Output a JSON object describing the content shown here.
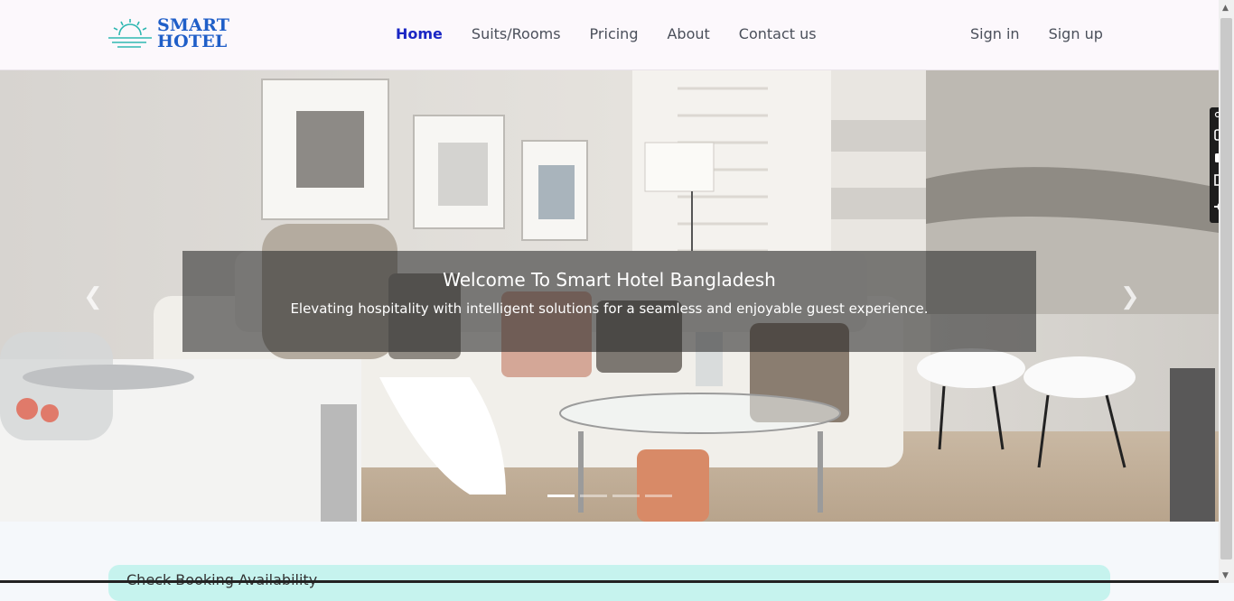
{
  "brand": {
    "line1": "SMART",
    "line2": "HOTEL"
  },
  "nav": {
    "links": [
      "Home",
      "Suits/Rooms",
      "Pricing",
      "About",
      "Contact us"
    ],
    "active": "Home"
  },
  "auth": {
    "sign_in": "Sign in",
    "sign_up": "Sign up"
  },
  "hero": {
    "title": "Welcome To Smart Hotel Bangladesh",
    "subtitle": "Elevating hospitality with intelligent solutions for a seamless and enjoyable guest experience.",
    "prev_icon": "chevron-left-icon",
    "next_icon": "chevron-right-icon",
    "slides": 4,
    "active_slide": 1
  },
  "booking": {
    "label": "Check Booking Availability"
  },
  "colors": {
    "accent": "#1a26c4",
    "brand": "#1f5ec8",
    "booking_bg": "#c6f3ee"
  }
}
